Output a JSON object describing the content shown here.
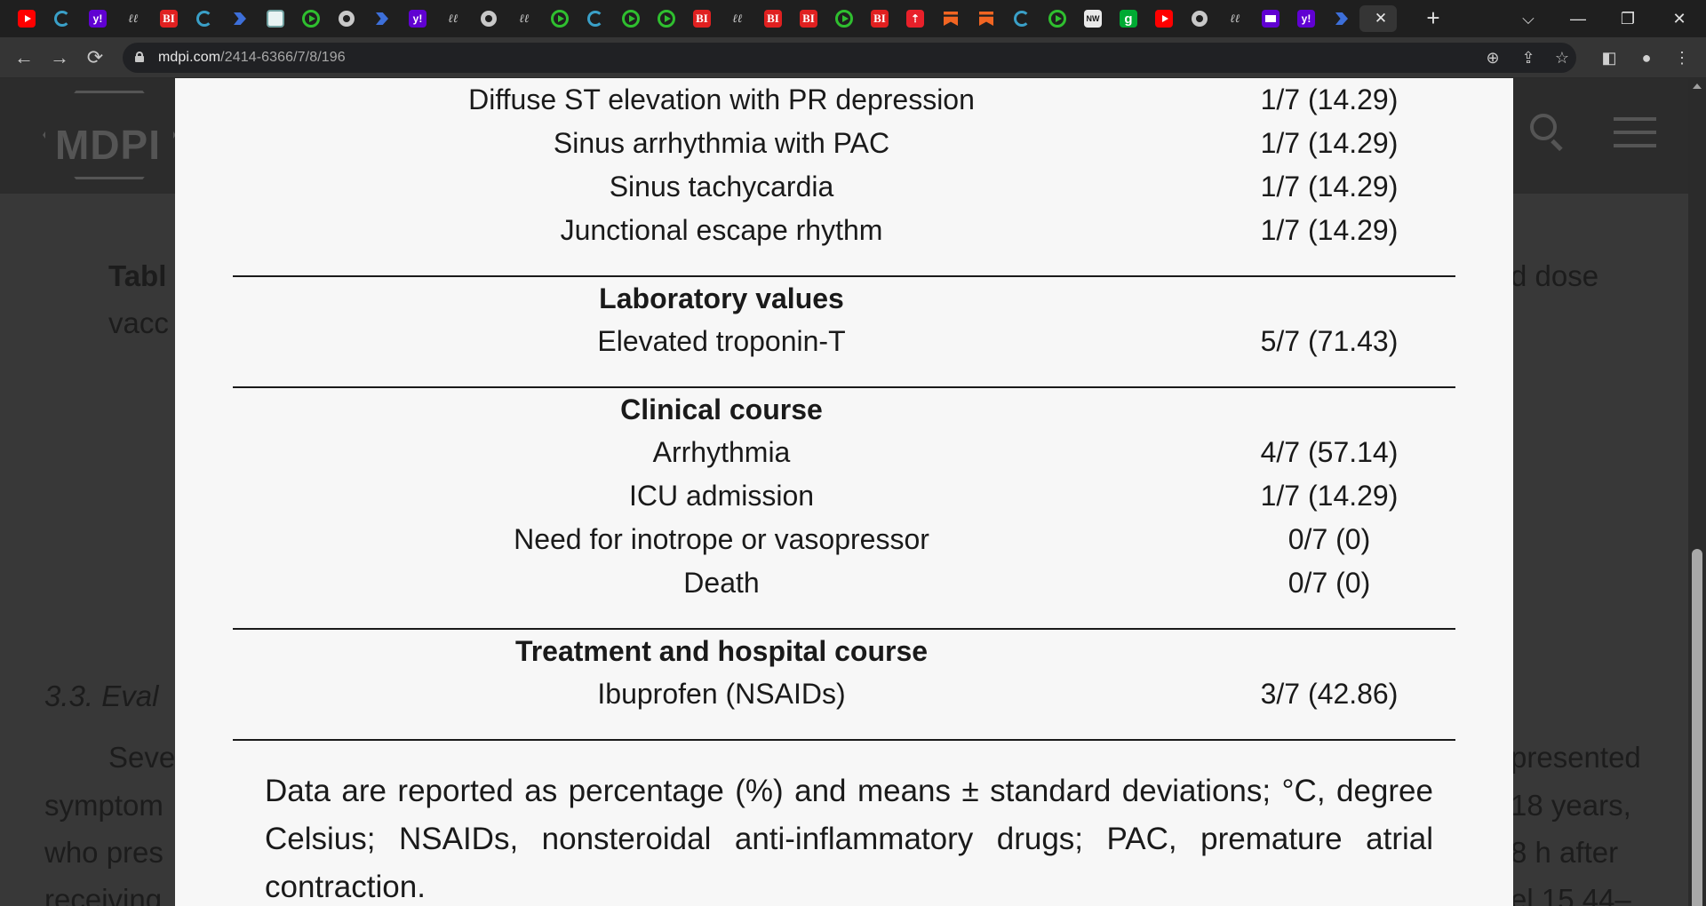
{
  "browser": {
    "active_tab_close": "✕",
    "new_tab": "+",
    "url_host": "mdpi.com",
    "url_path": "/2414-6366/7/8/196",
    "window_controls": {
      "tab_search": "⌵",
      "minimize": "—",
      "restore": "❐",
      "close": "✕"
    },
    "tabs": [
      {
        "icon": "youtube-icon"
      },
      {
        "icon": "ring-icon"
      },
      {
        "icon": "yahoo-icon",
        "glyph": "y!"
      },
      {
        "icon": "handwriting-icon",
        "glyph": "ℓℓ"
      },
      {
        "icon": "bi-icon",
        "glyph": "BI"
      },
      {
        "icon": "ring-icon"
      },
      {
        "icon": "arrow-icon"
      },
      {
        "icon": "grid-icon"
      },
      {
        "icon": "play-icon"
      },
      {
        "icon": "globe-icon"
      },
      {
        "icon": "arrow-icon"
      },
      {
        "icon": "yahoo-icon",
        "glyph": "y!"
      },
      {
        "icon": "handwriting-icon",
        "glyph": "ℓℓ"
      },
      {
        "icon": "globe-icon"
      },
      {
        "icon": "handwriting-icon",
        "glyph": "ℓℓ"
      },
      {
        "icon": "play-icon"
      },
      {
        "icon": "ring-icon"
      },
      {
        "icon": "play-icon"
      },
      {
        "icon": "play-icon"
      },
      {
        "icon": "bi-icon",
        "glyph": "BI"
      },
      {
        "icon": "handwriting-icon",
        "glyph": "ℓℓ"
      },
      {
        "icon": "bi-icon",
        "glyph": "BI"
      },
      {
        "icon": "bi-icon",
        "glyph": "BI"
      },
      {
        "icon": "play-icon"
      },
      {
        "icon": "bi-icon",
        "glyph": "BI"
      },
      {
        "icon": "red-up-icon",
        "glyph": "⇡"
      },
      {
        "icon": "ribbon-icon"
      },
      {
        "icon": "ribbon-icon"
      },
      {
        "icon": "ring-icon"
      },
      {
        "icon": "play-icon"
      },
      {
        "icon": "nyt-icon",
        "glyph": "NW"
      },
      {
        "icon": "g-icon",
        "glyph": "g"
      },
      {
        "icon": "youtube-icon"
      },
      {
        "icon": "globe-icon"
      },
      {
        "icon": "handwriting-icon",
        "glyph": "ℓℓ"
      },
      {
        "icon": "mail-icon"
      },
      {
        "icon": "yahoo-icon",
        "glyph": "y!"
      },
      {
        "icon": "arrow-icon"
      }
    ]
  },
  "background_article": {
    "logo": "MDPI",
    "lines": [
      {
        "text": "Tabl",
        "style": "bold"
      },
      {
        "text": "d dose",
        "style": "normal"
      },
      {
        "text": "vacc",
        "style": "normal"
      },
      {
        "text": "3.3. Eval",
        "style": "ital"
      },
      {
        "text": "Seve",
        "style": "normal"
      },
      {
        "text": "presented",
        "style": "normal"
      },
      {
        "text": "symptom",
        "style": "normal"
      },
      {
        "text": "18 years,",
        "style": "normal"
      },
      {
        "text": "who pres",
        "style": "normal"
      },
      {
        "text": "8 h after",
        "style": "normal"
      },
      {
        "text": "receiving",
        "style": "normal"
      },
      {
        "text": "el 15.44–",
        "style": "normal"
      }
    ]
  },
  "table": {
    "rows": [
      {
        "label": "Diffuse ST elevation with PR depression",
        "value": "1/7 (14.29)"
      },
      {
        "label": "Sinus arrhythmia with PAC",
        "value": "1/7 (14.29)"
      },
      {
        "label": "Sinus tachycardia",
        "value": "1/7 (14.29)"
      },
      {
        "label": "Junctional escape rhythm",
        "value": "1/7 (14.29)"
      }
    ],
    "sections": [
      {
        "heading": "Laboratory values",
        "rows": [
          {
            "label": "Elevated troponin-T",
            "value": "5/7 (71.43)"
          }
        ]
      },
      {
        "heading": "Clinical course",
        "rows": [
          {
            "label": "Arrhythmia",
            "value": "4/7 (57.14)"
          },
          {
            "label": "ICU admission",
            "value": "1/7 (14.29)"
          },
          {
            "label": "Need for inotrope or vasopressor",
            "value": "0/7 (0)"
          },
          {
            "label": "Death",
            "value": "0/7 (0)"
          }
        ]
      },
      {
        "heading": "Treatment and hospital course",
        "rows": [
          {
            "label": "Ibuprofen (NSAIDs)",
            "value": "3/7 (42.86)"
          }
        ]
      }
    ]
  },
  "footnote": "Data are reported as percentage (%) and means ± standard deviations; °C, degree Celsius; NSAIDs, nonsteroidal anti-inflammatory drugs; PAC, premature atrial contraction."
}
